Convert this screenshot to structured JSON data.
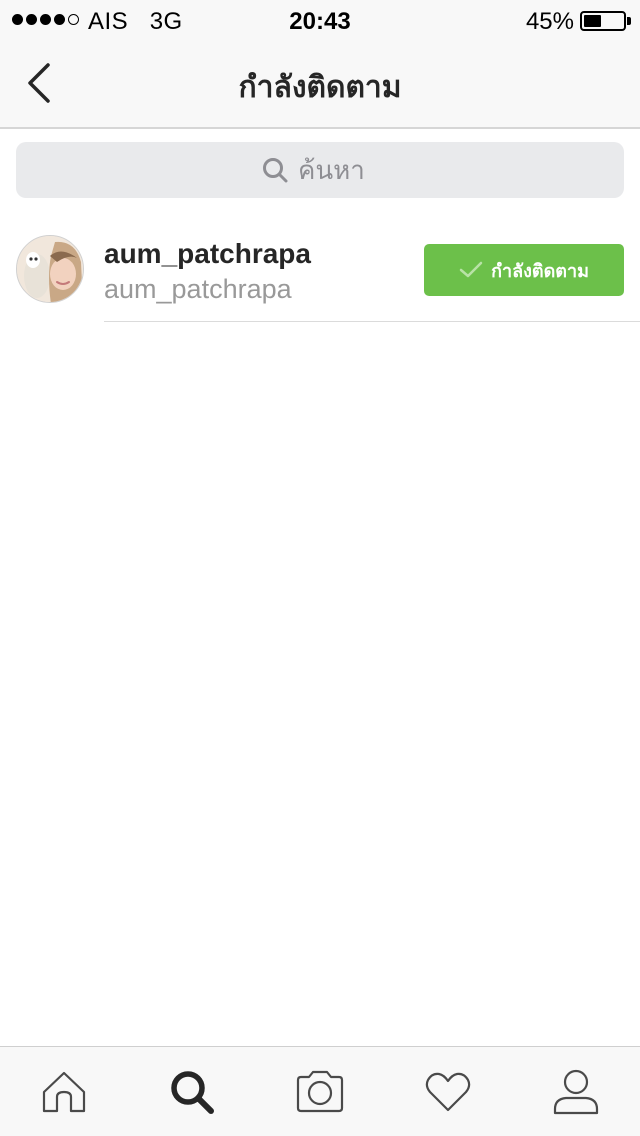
{
  "status_bar": {
    "carrier": "AIS",
    "network": "3G",
    "time": "20:43",
    "battery_percent": "45%",
    "battery_level": 0.45,
    "signal_filled": 4,
    "signal_total": 5
  },
  "nav": {
    "title": "กำลังติดตาม",
    "back_icon": "chevron-left-icon"
  },
  "search": {
    "placeholder": "ค้นหา",
    "icon": "search-icon"
  },
  "following": [
    {
      "username": "aum_patchrapa",
      "full_name": "aum_patchrapa",
      "button_label": "กำลังติดตาม",
      "button_icon": "checkmark-icon"
    }
  ],
  "tabs": [
    {
      "name": "home",
      "icon": "home-icon",
      "active": false
    },
    {
      "name": "search",
      "icon": "search-icon",
      "active": true
    },
    {
      "name": "camera",
      "icon": "camera-icon",
      "active": false
    },
    {
      "name": "activity",
      "icon": "heart-icon",
      "active": false
    },
    {
      "name": "profile",
      "icon": "person-icon",
      "active": false
    }
  ],
  "colors": {
    "follow_button": "#6cc04a",
    "bar_background": "#f8f8f8",
    "search_background": "#e9eaec"
  }
}
